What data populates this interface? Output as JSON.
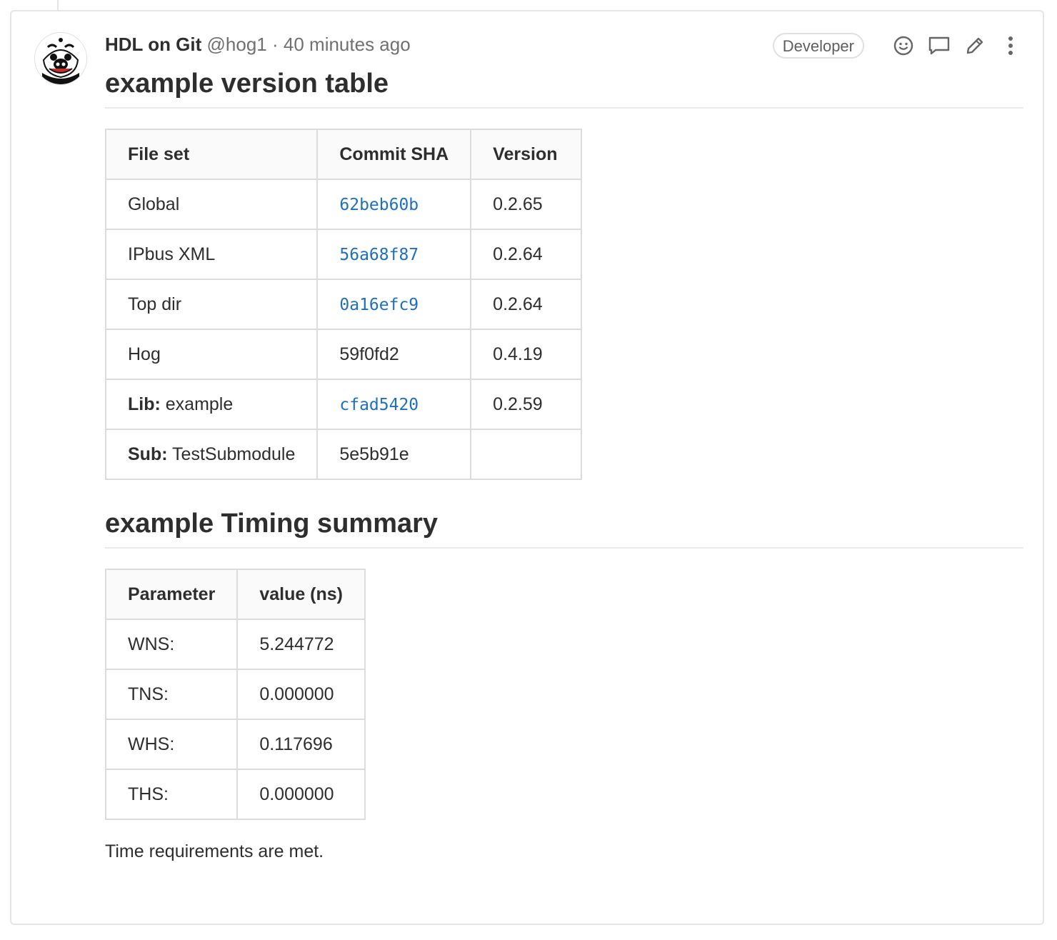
{
  "author": {
    "name": "HDL on Git",
    "handle": "@hog1",
    "separator": "·",
    "time_ago": "40 minutes ago",
    "role": "Developer"
  },
  "actions": {
    "icons": [
      "smiley-icon",
      "comment-icon",
      "pencil-icon",
      "more-vertical-icon"
    ]
  },
  "version_section": {
    "title": "example version table",
    "headers": [
      "File set",
      "Commit SHA",
      "Version"
    ],
    "rows": [
      {
        "prefix": "",
        "file_set": "Global",
        "sha": "62beb60b",
        "sha_is_link": true,
        "version": "0.2.65"
      },
      {
        "prefix": "",
        "file_set": "IPbus XML",
        "sha": "56a68f87",
        "sha_is_link": true,
        "version": "0.2.64"
      },
      {
        "prefix": "",
        "file_set": "Top dir",
        "sha": "0a16efc9",
        "sha_is_link": true,
        "version": "0.2.64"
      },
      {
        "prefix": "",
        "file_set": "Hog",
        "sha": "59f0fd2",
        "sha_is_link": false,
        "version": "0.4.19"
      },
      {
        "prefix": "Lib:",
        "file_set": " example",
        "sha": "cfad5420",
        "sha_is_link": true,
        "version": "0.2.59"
      },
      {
        "prefix": "Sub:",
        "file_set": " TestSubmodule",
        "sha": "5e5b91e",
        "sha_is_link": false,
        "version": ""
      }
    ]
  },
  "timing_section": {
    "title": "example Timing summary",
    "headers": [
      "Parameter",
      "value (ns)"
    ],
    "rows": [
      {
        "parameter": "WNS:",
        "value": "5.244772"
      },
      {
        "parameter": "TNS:",
        "value": "0.000000"
      },
      {
        "parameter": "WHS:",
        "value": "0.117696"
      },
      {
        "parameter": "THS:",
        "value": "0.000000"
      }
    ]
  },
  "footer": {
    "text": "Time requirements are met."
  },
  "colors": {
    "link": "#1f6fbf",
    "border": "#dcdcdc",
    "muted": "#707070"
  }
}
